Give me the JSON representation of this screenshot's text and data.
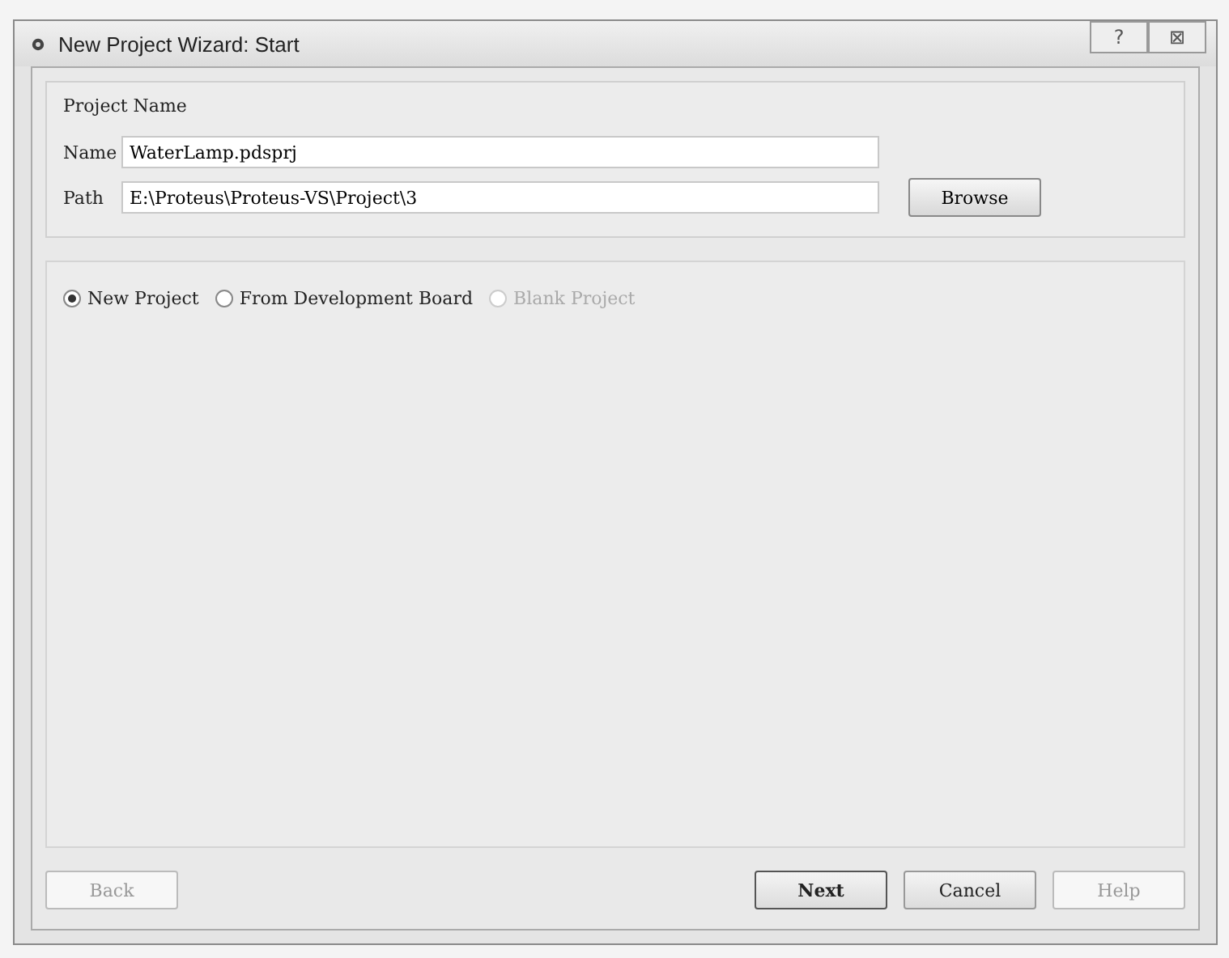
{
  "window": {
    "title": "New Project Wizard: Start",
    "title_buttons": [
      "?",
      "⊠"
    ]
  },
  "project_name": {
    "legend": "Project Name",
    "fields": [
      {
        "label": "Name",
        "value": "WaterLamp.pdsprj"
      },
      {
        "label": "Path",
        "value": "E:\\Proteus\\Proteus-VS\\Project\\3",
        "button": "Browse"
      }
    ]
  },
  "project_type": [
    {
      "label": "New Project",
      "selected": true,
      "disabled": false
    },
    {
      "label": "From Development Board",
      "selected": false,
      "disabled": false
    },
    {
      "label": "Blank Project",
      "selected": false,
      "disabled": true
    }
  ],
  "buttons": [
    {
      "label": "Back",
      "disabled": true,
      "default": false
    },
    {
      "label": "Next",
      "disabled": false,
      "default": true
    },
    {
      "label": "Cancel",
      "disabled": false,
      "default": false
    },
    {
      "label": "Help",
      "disabled": true,
      "default": false
    }
  ]
}
